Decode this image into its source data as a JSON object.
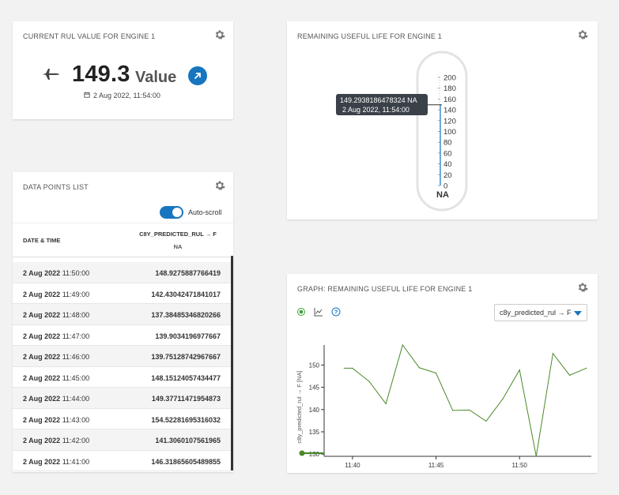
{
  "cards": {
    "rul": {
      "title": "CURRENT RUL VALUE FOR ENGINE 1",
      "value": "149.3",
      "unit": "Value",
      "timestamp": "2 Aug 2022, 11:54:00"
    },
    "thermometer": {
      "title": "REMAINING USEFUL LIFE FOR ENGINE 1",
      "tooltip_value": "149.2938186478324 NA",
      "tooltip_time": "2 Aug 2022, 11:54:00",
      "unit_label": "NA",
      "scale": [
        "200",
        "180",
        "160",
        "140",
        "120",
        "100",
        "80",
        "60",
        "40",
        "20",
        "0"
      ],
      "level": 149.29
    },
    "list": {
      "title": "DATA POINTS LIST",
      "autoscroll_label": "Auto-scroll",
      "col_date": "DATE & TIME",
      "col_series": "C8Y_PREDICTED_RUL → F",
      "col_unit": "NA",
      "rows": [
        {
          "date": "2 Aug 2022",
          "time": "11:50:00",
          "value": "148.9275887766419"
        },
        {
          "date": "2 Aug 2022",
          "time": "11:49:00",
          "value": "142.43042471841017"
        },
        {
          "date": "2 Aug 2022",
          "time": "11:48:00",
          "value": "137.38485346820266"
        },
        {
          "date": "2 Aug 2022",
          "time": "11:47:00",
          "value": "139.9034196977667"
        },
        {
          "date": "2 Aug 2022",
          "time": "11:46:00",
          "value": "139.75128742967667"
        },
        {
          "date": "2 Aug 2022",
          "time": "11:45:00",
          "value": "148.15124057434477"
        },
        {
          "date": "2 Aug 2022",
          "time": "11:44:00",
          "value": "149.37711471954873"
        },
        {
          "date": "2 Aug 2022",
          "time": "11:43:00",
          "value": "154.52281695316032"
        },
        {
          "date": "2 Aug 2022",
          "time": "11:42:00",
          "value": "141.3060107561965"
        },
        {
          "date": "2 Aug 2022",
          "time": "11:41:00",
          "value": "146.31865605489855"
        }
      ]
    },
    "graph": {
      "title": "GRAPH: REMAINING USEFUL LIFE FOR ENGINE 1",
      "series_select": "c8y_predicted_rul → F"
    }
  },
  "chart_data": {
    "type": "line",
    "title": "",
    "xlabel": "",
    "ylabel": "c8y_predicted_rul → F [NA]",
    "x_ticks": [
      "11:40",
      "11:45",
      "11:50"
    ],
    "y_ticks": [
      130,
      135,
      140,
      145,
      150
    ],
    "ylim": [
      129.5,
      154.5
    ],
    "xlim_minutes": [
      38.3,
      54.3
    ],
    "series": [
      {
        "color": "#4a8a2a",
        "points": [
          [
            39.5,
            149.3
          ],
          [
            40.0,
            149.3
          ],
          [
            41.0,
            146.3
          ],
          [
            42.0,
            141.3
          ],
          [
            43.0,
            154.5
          ],
          [
            44.0,
            149.4
          ],
          [
            45.0,
            148.2
          ],
          [
            46.0,
            139.8
          ],
          [
            47.0,
            139.9
          ],
          [
            48.0,
            137.4
          ],
          [
            49.0,
            142.4
          ],
          [
            50.0,
            148.9
          ],
          [
            51.0,
            129.5
          ],
          [
            52.0,
            152.6
          ],
          [
            53.0,
            147.7
          ],
          [
            54.0,
            149.3
          ]
        ]
      }
    ],
    "grid": false,
    "legend": "none"
  },
  "colors": {
    "accent": "#1776bf",
    "series": "#4a8a2a",
    "tooltip_bg": "#3a4148"
  },
  "icons": {
    "settings": "gear-icon",
    "engine": "airplane-icon",
    "link": "arrow-up-right-icon",
    "calendar": "calendar-icon",
    "help": "question-circle-icon",
    "chart": "line-chart-icon"
  }
}
